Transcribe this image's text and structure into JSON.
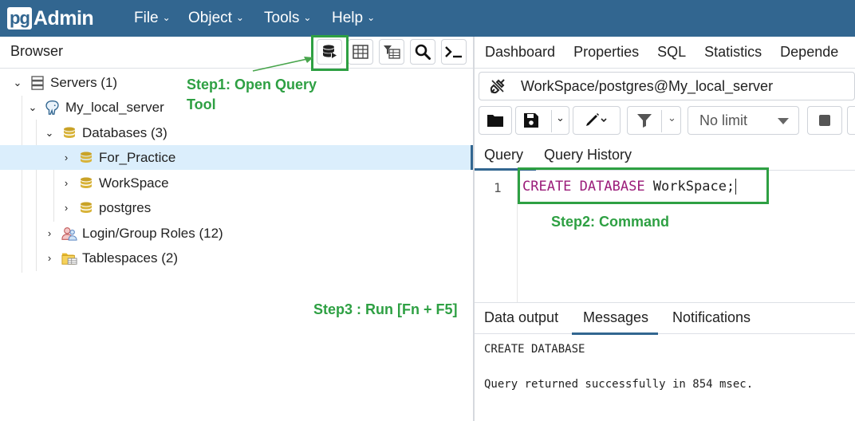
{
  "app": {
    "logo_pg": "pg",
    "logo_admin": "Admin"
  },
  "menu": [
    {
      "label": "File"
    },
    {
      "label": "Object"
    },
    {
      "label": "Tools"
    },
    {
      "label": "Help"
    }
  ],
  "browser": {
    "title": "Browser",
    "tree": [
      {
        "label": "Servers (1)",
        "icon": "servers-icon"
      },
      {
        "label": "My_local_server",
        "icon": "elephant-icon"
      },
      {
        "label": "Databases (3)",
        "icon": "database-icon"
      },
      {
        "label": "For_Practice",
        "icon": "database-icon"
      },
      {
        "label": "WorkSpace",
        "icon": "database-icon"
      },
      {
        "label": "postgres",
        "icon": "database-icon"
      },
      {
        "label": "Login/Group Roles (12)",
        "icon": "roles-icon"
      },
      {
        "label": "Tablespaces (2)",
        "icon": "tablespaces-icon"
      }
    ]
  },
  "annotations": {
    "step1_line1": "Step1: Open Query",
    "step1_line2": "Tool",
    "step2": "Step2: Command",
    "step3": "Step3 : Run [Fn + F5]"
  },
  "main_tabs": [
    "Dashboard",
    "Properties",
    "SQL",
    "Statistics",
    "Depende"
  ],
  "connection": {
    "label": "WorkSpace/postgres@My_local_server"
  },
  "query_toolbar": {
    "limit_label": "No limit"
  },
  "query_tabs": [
    "Query",
    "Query History"
  ],
  "editor": {
    "line_number": "1",
    "kw1": "CREATE",
    "kw2": "DATABASE",
    "ident": "WorkSpace;"
  },
  "output_tabs": [
    "Data output",
    "Messages",
    "Notifications"
  ],
  "messages": {
    "line1": "CREATE DATABASE",
    "line2": "Query returned successfully in 854 msec."
  },
  "colors": {
    "nav": "#326690",
    "highlight": "#2ea043",
    "keyword": "#9b1d7a",
    "selected_row": "#dbeefc"
  }
}
